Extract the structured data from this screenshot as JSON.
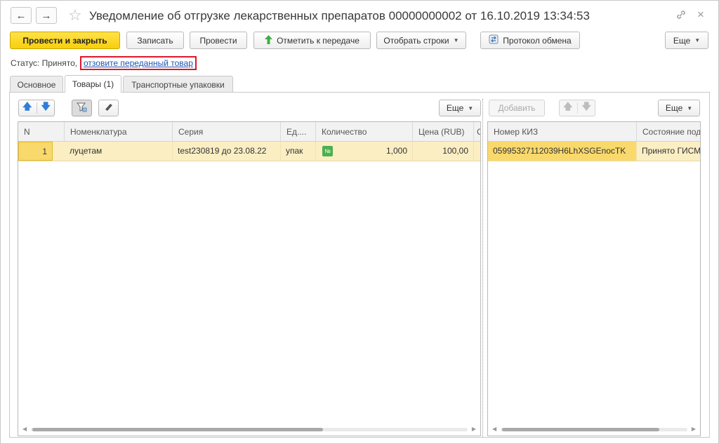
{
  "window": {
    "title": "Уведомление об отгрузке лекарственных препаратов 00000000002 от 16.10.2019 13:34:53",
    "back_icon": "←",
    "forward_icon": "→",
    "favorite_icon": "☆",
    "link_icon": "⊘",
    "close_icon": "×"
  },
  "toolbar": {
    "post_close": "Провести и закрыть",
    "save": "Записать",
    "post": "Провести",
    "mark_transfer": "Отметить к передаче",
    "select_rows": "Отобрать строки",
    "exchange_log": "Протокол обмена",
    "more": "Еще"
  },
  "status": {
    "label": "Статус:",
    "value": "Принято,",
    "link": "отзовите переданный товар"
  },
  "tabs": [
    {
      "label": "Основное"
    },
    {
      "label": "Товары (1)"
    },
    {
      "label": "Транспортные упаковки"
    }
  ],
  "left_panel": {
    "more": "Еще",
    "columns": [
      "N",
      "Номенклатура",
      "Серия",
      "Ед....",
      "Количество",
      "Цена (RUB)",
      "С"
    ],
    "rows": [
      {
        "n": "1",
        "item": "луцетам",
        "series": "test230819 до 23.08.22",
        "unit": "упак",
        "badge": "№",
        "qty": "1,000",
        "price": "100,00"
      }
    ]
  },
  "right_panel": {
    "add": "Добавить",
    "more": "Еще",
    "columns": [
      "Номер КИЗ",
      "Состояние под"
    ],
    "rows": [
      {
        "kiz": "05995327112039H6LhXSGEnocTK",
        "state": "Принято ГИСМ"
      }
    ]
  },
  "colors": {
    "primary_button": "#f7cf0c",
    "selected_row": "#fbeec3",
    "link": "#1c55b6",
    "highlight_border": "#e0162b"
  }
}
